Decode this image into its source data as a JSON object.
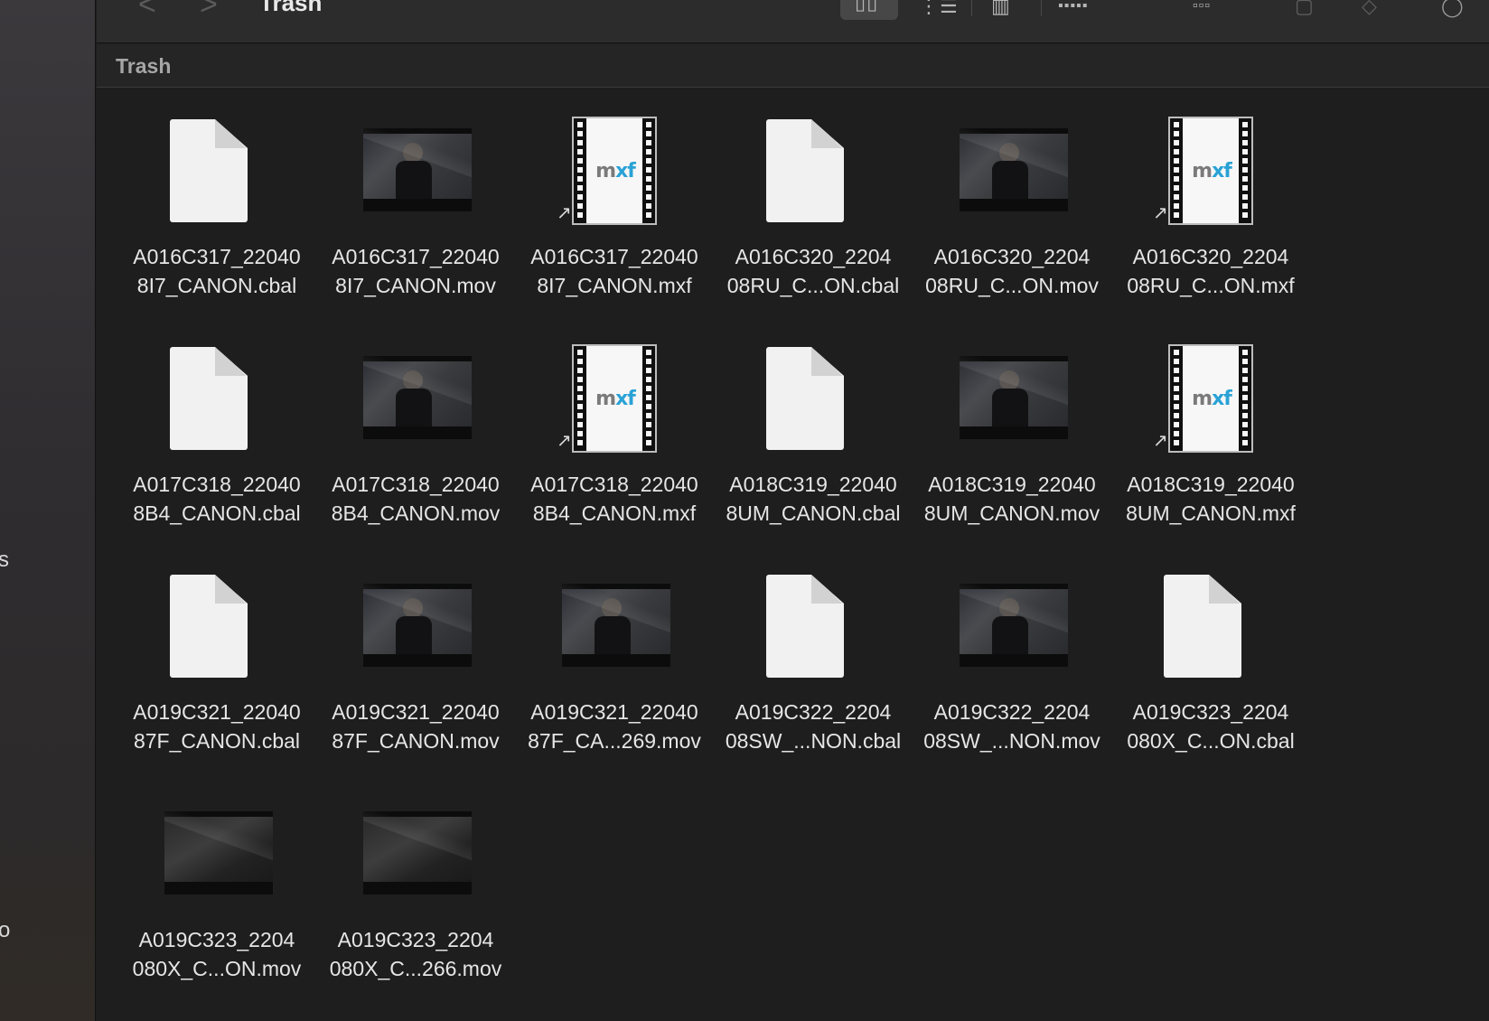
{
  "window": {
    "title": "Trash",
    "back_arrow": "<",
    "forward_arrow": ">"
  },
  "toolbar": {
    "view_icons": "grid-view-icon",
    "view_list": "list-view-icon",
    "view_columns": "column-view-icon",
    "view_gallery": "gallery-view-icon",
    "group_icon": "group-by-icon",
    "share_icon": "share-icon",
    "tag_icon": "tag-icon",
    "more_icon": "more-icon"
  },
  "sidebar": {
    "fragment_1": "s",
    "fragment_2": "o"
  },
  "path_header": {
    "title": "Trash"
  },
  "colors": {
    "background": "#1e1e1e",
    "mxf_blue": "#2aa2d6"
  },
  "files": [
    {
      "kind": "doc",
      "line1": "A016C317_22040",
      "line2": "8I7_CANON.cbal"
    },
    {
      "kind": "video",
      "line1": "A016C317_22040",
      "line2": "8I7_CANON.mov"
    },
    {
      "kind": "mxf",
      "line1": "A016C317_22040",
      "line2": "8I7_CANON.mxf"
    },
    {
      "kind": "doc",
      "line1": "A016C320_2204",
      "line2": "08RU_C...ON.cbal"
    },
    {
      "kind": "video",
      "line1": "A016C320_2204",
      "line2": "08RU_C...ON.mov"
    },
    {
      "kind": "mxf",
      "line1": "A016C320_2204",
      "line2": "08RU_C...ON.mxf"
    },
    {
      "kind": "doc",
      "line1": "A017C318_22040",
      "line2": "8B4_CANON.cbal"
    },
    {
      "kind": "video",
      "line1": "A017C318_22040",
      "line2": "8B4_CANON.mov"
    },
    {
      "kind": "mxf",
      "line1": "A017C318_22040",
      "line2": "8B4_CANON.mxf"
    },
    {
      "kind": "doc",
      "line1": "A018C319_22040",
      "line2": "8UM_CANON.cbal"
    },
    {
      "kind": "video",
      "line1": "A018C319_22040",
      "line2": "8UM_CANON.mov"
    },
    {
      "kind": "mxf",
      "line1": "A018C319_22040",
      "line2": "8UM_CANON.mxf"
    },
    {
      "kind": "doc",
      "line1": "A019C321_22040",
      "line2": "87F_CANON.cbal"
    },
    {
      "kind": "video",
      "line1": "A019C321_22040",
      "line2": "87F_CANON.mov"
    },
    {
      "kind": "video",
      "line1": "A019C321_22040",
      "line2": "87F_CA...269.mov"
    },
    {
      "kind": "doc",
      "line1": "A019C322_2204",
      "line2": "08SW_...NON.cbal"
    },
    {
      "kind": "video",
      "line1": "A019C322_2204",
      "line2": "08SW_...NON.mov"
    },
    {
      "kind": "doc",
      "line1": "A019C323_2204",
      "line2": "080X_C...ON.cbal"
    },
    {
      "kind": "video-dark",
      "line1": "A019C323_2204",
      "line2": "080X_C...ON.mov"
    },
    {
      "kind": "video-dark",
      "line1": "A019C323_2204",
      "line2": "080X_C...266.mov"
    }
  ]
}
